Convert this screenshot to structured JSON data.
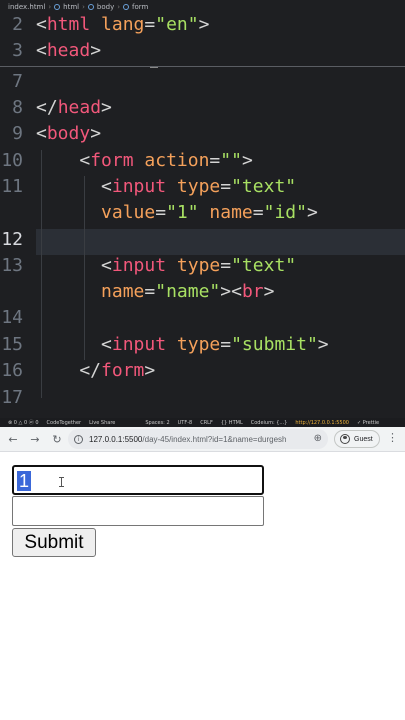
{
  "editor": {
    "breadcrumb": [
      "index.html",
      "html",
      "body",
      "form"
    ],
    "active_line": "12",
    "lines": [
      {
        "no": "2",
        "tokens": [
          [
            "pun",
            "<"
          ],
          [
            "tag",
            "html"
          ],
          [
            "pun",
            " "
          ],
          [
            "attr",
            "lang"
          ],
          [
            "pun",
            "="
          ],
          [
            "str",
            "\"en\""
          ],
          [
            "pun",
            ">"
          ]
        ]
      },
      {
        "no": "3",
        "tokens": [
          [
            "pun",
            "<"
          ],
          [
            "tag",
            "head"
          ],
          [
            "pun",
            ">"
          ]
        ]
      },
      {
        "no": "7",
        "tokens": []
      },
      {
        "no": "8",
        "tokens": [
          [
            "pun",
            "</"
          ],
          [
            "tag",
            "head"
          ],
          [
            "pun",
            ">"
          ]
        ]
      },
      {
        "no": "9",
        "tokens": [
          [
            "pun",
            "<"
          ],
          [
            "tag",
            "body"
          ],
          [
            "pun",
            ">"
          ]
        ]
      },
      {
        "no": "10",
        "tokens": [
          [
            "pun",
            "    <"
          ],
          [
            "tag",
            "form"
          ],
          [
            "pun",
            " "
          ],
          [
            "attr",
            "action"
          ],
          [
            "pun",
            "="
          ],
          [
            "str",
            "\"\""
          ],
          [
            "pun",
            ">"
          ]
        ]
      },
      {
        "no": "11",
        "tokens": [
          [
            "pun",
            "      <"
          ],
          [
            "tag",
            "input"
          ],
          [
            "pun",
            " "
          ],
          [
            "attr",
            "type"
          ],
          [
            "pun",
            "="
          ],
          [
            "str",
            "\"text\""
          ]
        ]
      },
      {
        "no": "",
        "tokens": [
          [
            "pun",
            "      "
          ],
          [
            "attr",
            "value"
          ],
          [
            "pun",
            "="
          ],
          [
            "str",
            "\"1\""
          ],
          [
            "pun",
            " "
          ],
          [
            "attr",
            "name"
          ],
          [
            "pun",
            "="
          ],
          [
            "str",
            "\"id\""
          ],
          [
            "pun",
            ">"
          ]
        ]
      },
      {
        "no": "12",
        "tokens": []
      },
      {
        "no": "13",
        "tokens": [
          [
            "pun",
            "      <"
          ],
          [
            "tag",
            "input"
          ],
          [
            "pun",
            " "
          ],
          [
            "attr",
            "type"
          ],
          [
            "pun",
            "="
          ],
          [
            "str",
            "\"text\""
          ]
        ]
      },
      {
        "no": "",
        "tokens": [
          [
            "pun",
            "      "
          ],
          [
            "attr",
            "name"
          ],
          [
            "pun",
            "="
          ],
          [
            "str",
            "\"name\""
          ],
          [
            "pun",
            "><"
          ],
          [
            "tag",
            "br"
          ],
          [
            "pun",
            ">"
          ]
        ]
      },
      {
        "no": "14",
        "tokens": []
      },
      {
        "no": "15",
        "tokens": [
          [
            "pun",
            "      <"
          ],
          [
            "tag",
            "input"
          ],
          [
            "pun",
            " "
          ],
          [
            "attr",
            "type"
          ],
          [
            "pun",
            "="
          ],
          [
            "str",
            "\"submit\""
          ],
          [
            "pun",
            ">"
          ]
        ]
      },
      {
        "no": "16",
        "tokens": [
          [
            "pun",
            "    </"
          ],
          [
            "tag",
            "form"
          ],
          [
            "pun",
            ">"
          ]
        ]
      },
      {
        "no": "17",
        "tokens": []
      }
    ]
  },
  "statusbar": {
    "left": "⊗ 0 △ 0  ⓦ 0",
    "items": [
      "CodeTogether",
      "Live Share",
      "Spaces: 2",
      "UTF-8",
      "CRLF",
      "{} HTML",
      "Codeium: {...}"
    ],
    "live_server": "http://127.0.0.1:5500",
    "prettier": "✓ Prettie"
  },
  "browser": {
    "url_host": "127.0.0.1:5500",
    "url_path": "/day-45/index.html?id=1&name=durgesh",
    "profile_label": "Guest",
    "icons": {
      "back": "back-arrow-icon",
      "forward": "forward-arrow-icon",
      "reload": "reload-icon",
      "info": "info-icon",
      "zoom": "zoom-icon",
      "menu": "kebab-menu-icon"
    }
  },
  "form": {
    "id_value": "1",
    "name_value": "",
    "submit_label": "Submit"
  }
}
